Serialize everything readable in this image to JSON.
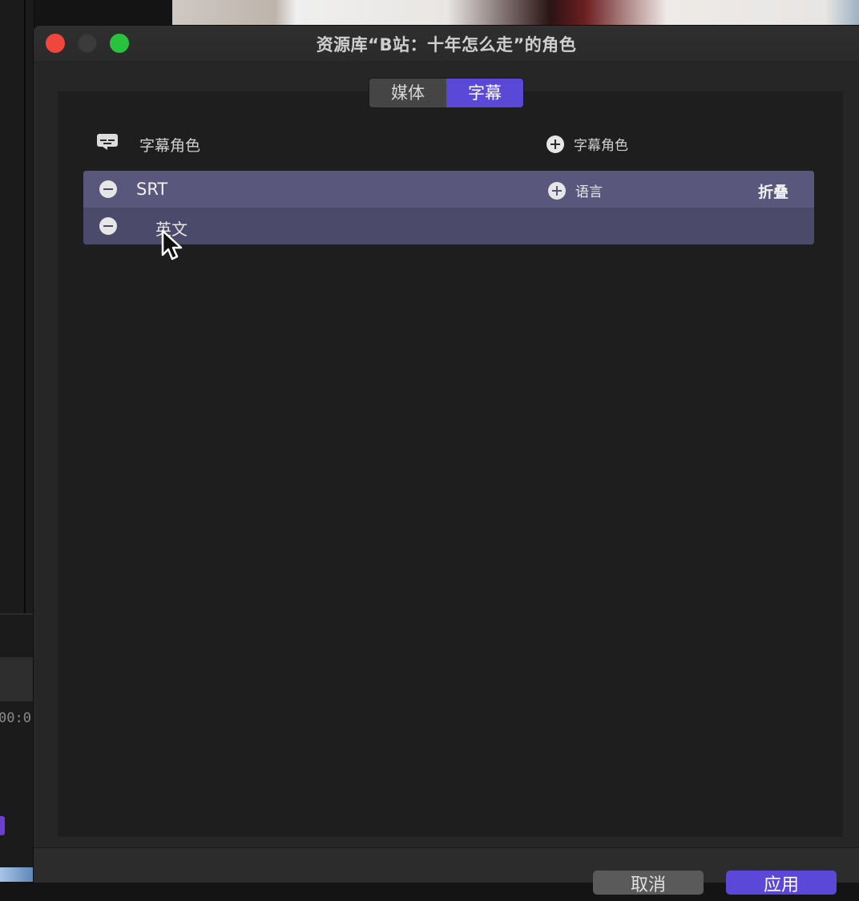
{
  "window": {
    "title": "资源库“B站：十年怎么走”的角色"
  },
  "tabs": [
    {
      "label": "媒体",
      "active": false
    },
    {
      "label": "字幕",
      "active": true
    }
  ],
  "header": {
    "section_label": "字幕角色",
    "add_role_label": "字幕角色"
  },
  "roles": [
    {
      "name": "SRT",
      "add_language_label": "语言",
      "collapse_label": "折叠",
      "subroles": [
        {
          "name": "英文"
        }
      ]
    }
  ],
  "footer": {
    "cancel_label": "取消",
    "apply_label": "应用"
  },
  "background": {
    "timecode": "00:0"
  },
  "colors": {
    "accent": "#5a48d6",
    "role_highlight": "#5a577c",
    "close": "#f0463c",
    "zoom": "#28c23c"
  },
  "icons": [
    "caption-icon",
    "plus-circle-icon",
    "minus-circle-icon",
    "cursor-icon"
  ]
}
